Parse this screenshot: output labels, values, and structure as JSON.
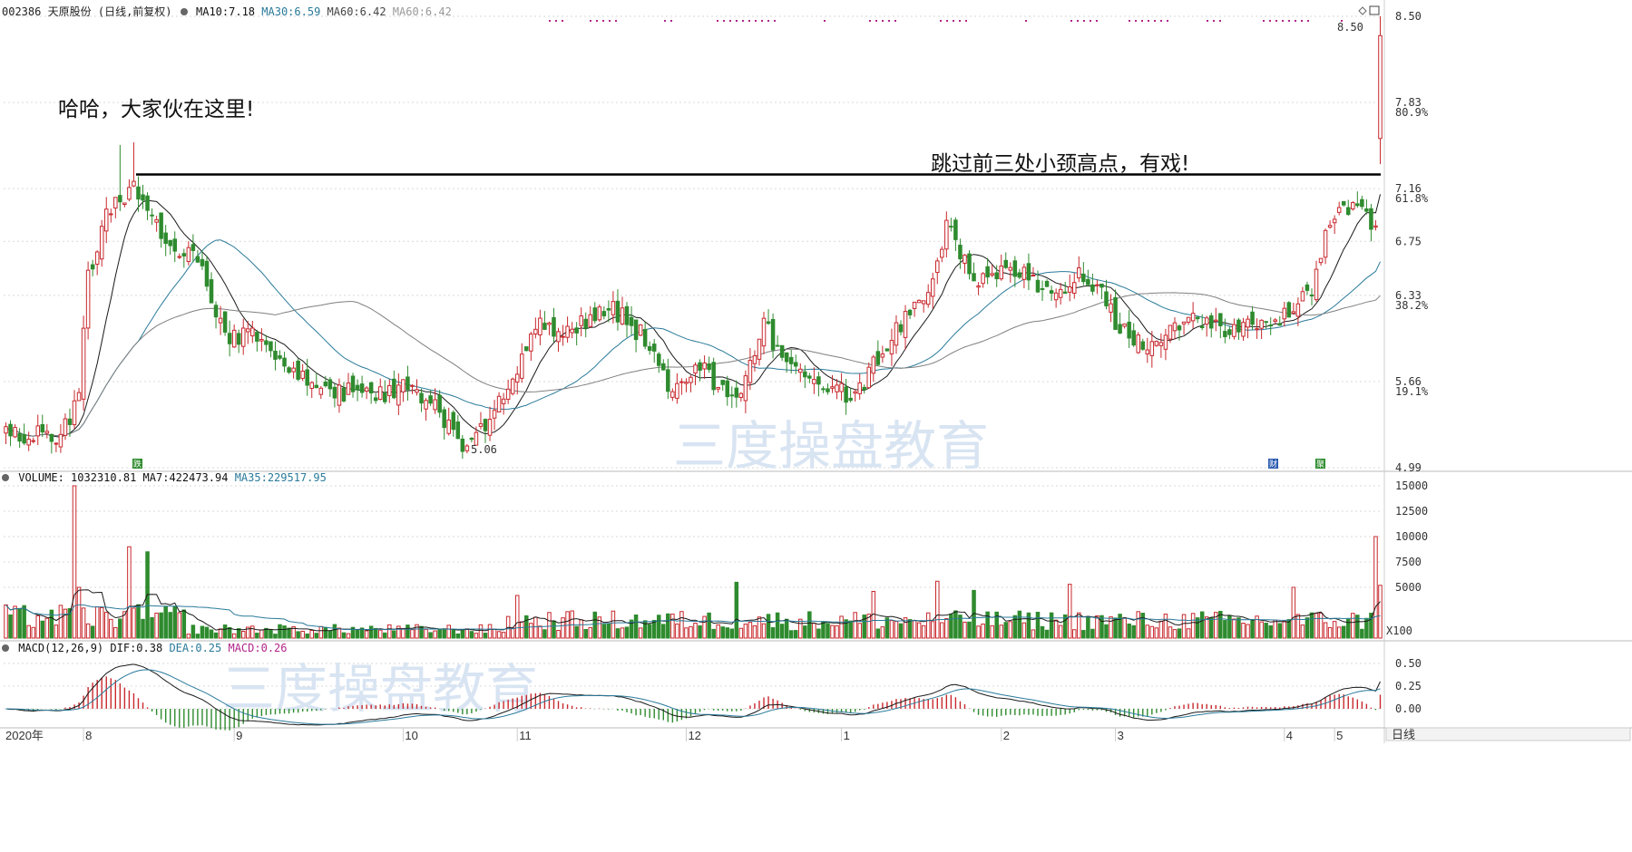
{
  "header": {
    "code": "002386",
    "name": "天原股份",
    "period": "(日线,前复权)",
    "ma10_label": "MA10:",
    "ma10": "7.18",
    "ma30_label": "MA30:",
    "ma30": "6.59",
    "ma60_label": "MA60:",
    "ma60": "6.42",
    "ma60b_label": "MA60:",
    "ma60b": "6.42"
  },
  "volume_header": {
    "label": "VOLUME:",
    "value": "1032310.81",
    "ma7_label": "MA7:",
    "ma7": "422473.94",
    "ma35_label": "MA35:",
    "ma35": "229517.95"
  },
  "macd_header": {
    "label": "MACD(12,26,9)",
    "dif_label": "DIF:",
    "dif": "0.38",
    "dea_label": "DEA:",
    "dea": "0.25",
    "macd_label": "MACD:",
    "macd": "0.26"
  },
  "annotations": {
    "left_note": "哈哈，大家伙在这里!",
    "right_note": "跳过前三处小颈高点，有戏!"
  },
  "watermark": "三度操盘教育",
  "price_axis": {
    "ticks": [
      "8.50",
      "7.83",
      "7.16",
      "6.75",
      "6.33",
      "5.66",
      "4.99"
    ],
    "pct": [
      "80.9%",
      "61.8%",
      "38.2%",
      "19.1%"
    ]
  },
  "volume_axis": {
    "ticks": [
      "15000",
      "12500",
      "10000",
      "7500",
      "5000"
    ],
    "unit": "X100"
  },
  "macd_axis": {
    "ticks": [
      "0.50",
      "0.25",
      "0.00"
    ]
  },
  "x_axis": {
    "labels": [
      "2020年",
      "8",
      "9",
      "10",
      "11",
      "12",
      "1",
      "2",
      "3",
      "4",
      "5"
    ],
    "period_button": "日线"
  },
  "markers": {
    "high_label": "8.50",
    "low_label": "5.06",
    "tag1": "跌",
    "tag2": "财",
    "tag3": "聚"
  },
  "colors": {
    "up": "#c8282d",
    "down": "#2e8b2e",
    "ma10": "#1a1a1a",
    "ma30": "#2a7a9a",
    "ma60": "#7f7f7f",
    "dif": "#1a1a1a",
    "dea": "#2a7a9a",
    "resistance": "#000000",
    "dots": "#b0258a",
    "grid": "#d9d9d9"
  },
  "chart_data": [
    {
      "type": "candlestick",
      "title": "天原股份 (日线,前复权)",
      "y_ticks": [
        4.99,
        5.66,
        6.33,
        6.75,
        7.16,
        7.83,
        8.5
      ],
      "ylim": [
        4.99,
        8.5
      ],
      "period": "2020年7月 – 2021年5月 (daily)",
      "key_points": {
        "period_high": 8.5,
        "period_low": 5.06,
        "last_ma10": 7.18,
        "last_ma30": 6.59,
        "last_ma60": 6.42
      },
      "resistance_level": 7.27,
      "month_labels": [
        "2020年",
        "8",
        "9",
        "10",
        "11",
        "12",
        "1",
        "2",
        "3",
        "4",
        "5"
      ],
      "waypoints": [
        [
          0,
          5.25
        ],
        [
          12,
          5.25
        ],
        [
          16,
          5.55
        ],
        [
          18,
          6.5
        ],
        [
          22,
          6.95
        ],
        [
          28,
          7.15
        ],
        [
          36,
          6.75
        ],
        [
          42,
          6.6
        ],
        [
          48,
          6.0
        ],
        [
          55,
          6.05
        ],
        [
          62,
          5.75
        ],
        [
          70,
          5.6
        ],
        [
          80,
          5.55
        ],
        [
          88,
          5.62
        ],
        [
          96,
          5.38
        ],
        [
          100,
          5.12
        ],
        [
          104,
          5.3
        ],
        [
          110,
          5.55
        ],
        [
          116,
          6.1
        ],
        [
          124,
          6.05
        ],
        [
          132,
          6.25
        ],
        [
          140,
          6.0
        ],
        [
          146,
          5.55
        ],
        [
          152,
          5.75
        ],
        [
          160,
          5.55
        ],
        [
          166,
          6.1
        ],
        [
          172,
          5.75
        ],
        [
          178,
          5.6
        ],
        [
          186,
          5.55
        ],
        [
          190,
          5.8
        ],
        [
          196,
          6.1
        ],
        [
          202,
          6.3
        ],
        [
          206,
          6.9
        ],
        [
          212,
          6.45
        ],
        [
          218,
          6.5
        ],
        [
          224,
          6.5
        ],
        [
          230,
          6.3
        ],
        [
          236,
          6.5
        ],
        [
          240,
          6.35
        ],
        [
          244,
          6.05
        ],
        [
          252,
          5.95
        ],
        [
          260,
          6.15
        ],
        [
          266,
          6.05
        ],
        [
          272,
          6.1
        ],
        [
          280,
          6.15
        ],
        [
          286,
          6.4
        ],
        [
          290,
          6.9
        ],
        [
          296,
          7.1
        ],
        [
          300,
          6.85
        ]
      ],
      "last_day": {
        "open": 7.55,
        "close": 8.35,
        "high": 8.5,
        "low": 7.35
      }
    },
    {
      "type": "bar",
      "title": "VOLUME",
      "unit": "X100",
      "y_ticks": [
        5000,
        7500,
        10000,
        12500,
        15000
      ],
      "ylim": [
        0,
        15000
      ],
      "peaks": [
        [
          15,
          15000
        ],
        [
          16,
          5000
        ],
        [
          27,
          9000
        ],
        [
          31,
          8500
        ],
        [
          112,
          4200
        ],
        [
          160,
          5500
        ],
        [
          190,
          4600
        ],
        [
          204,
          5600
        ],
        [
          212,
          4700
        ],
        [
          233,
          5300
        ],
        [
          282,
          5000
        ],
        [
          300,
          10000
        ],
        [
          301,
          5200
        ]
      ],
      "last": 10323,
      "ma7": 4225,
      "ma35": 2295
    },
    {
      "type": "bar+line",
      "title": "MACD(12,26,9)",
      "y_ticks": [
        0.0,
        0.25,
        0.5
      ],
      "ylim": [
        -0.2,
        0.6
      ],
      "dif_last": 0.38,
      "dea_last": 0.25,
      "macd_last": 0.26
    }
  ]
}
